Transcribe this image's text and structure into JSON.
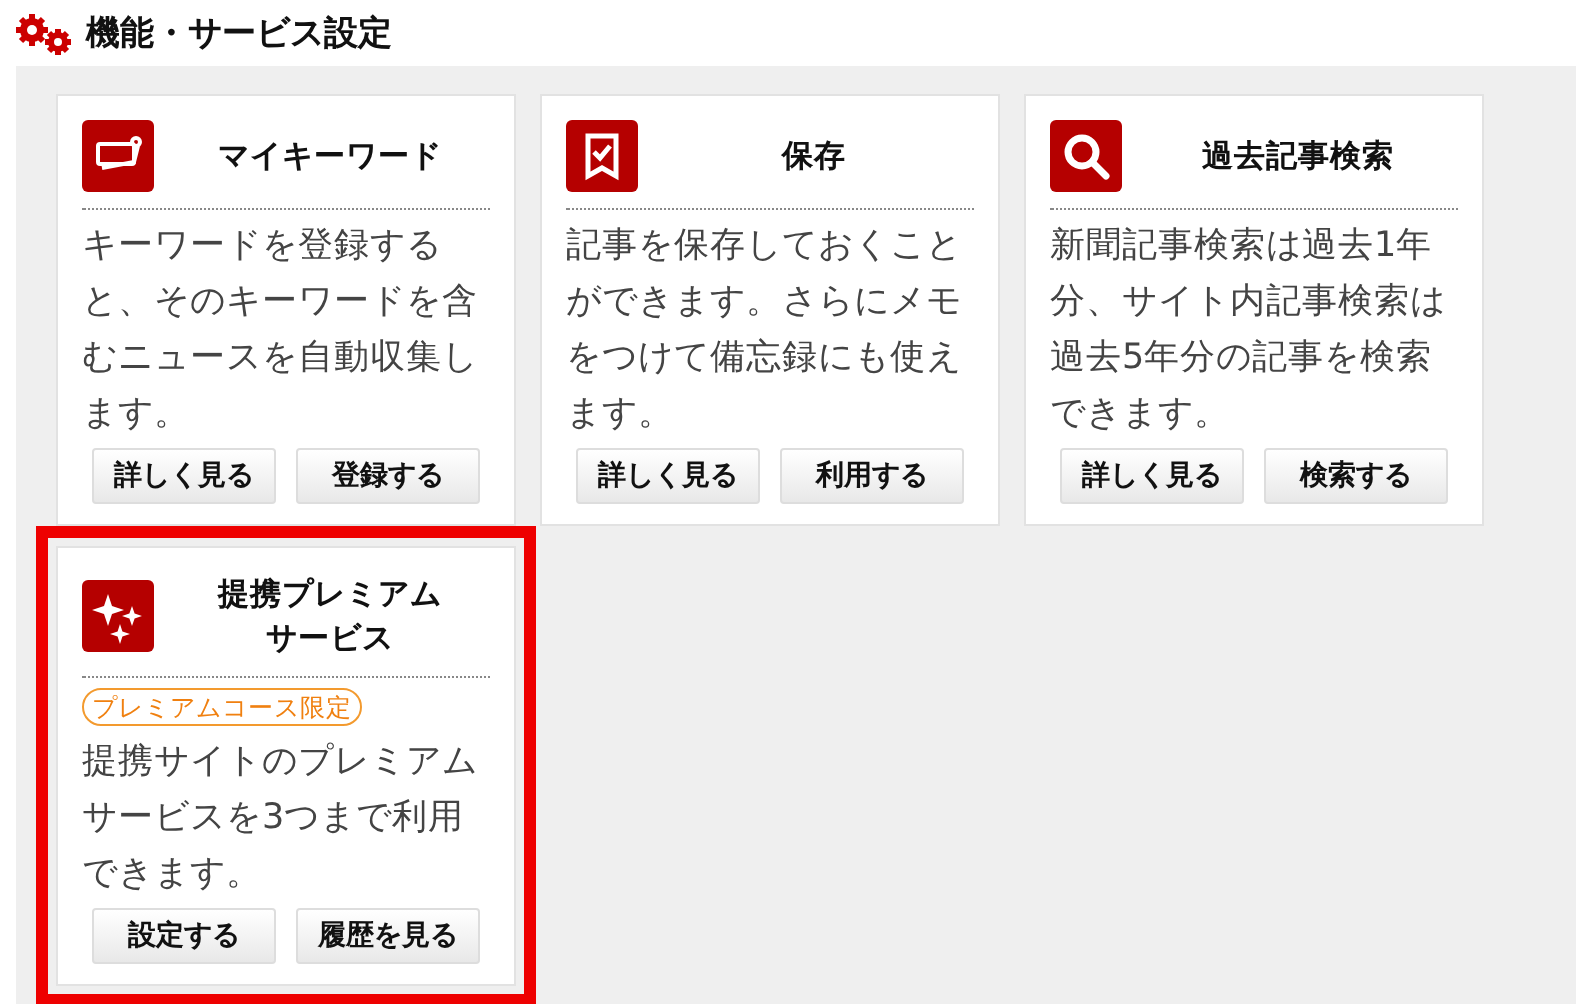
{
  "header": {
    "title": "機能・サービス設定"
  },
  "cards": [
    {
      "kind": "keyword",
      "title_lines": [
        "マイキーワード"
      ],
      "description_lines": [
        "キーワードを登録する",
        "と、そのキーワードを含",
        "むニュースを自動収集し",
        "ます。"
      ],
      "buttons": [
        "詳しく見る",
        "登録する"
      ],
      "highlighted": false
    },
    {
      "kind": "save",
      "title_lines": [
        "保存"
      ],
      "description_lines": [
        "記事を保存しておくこと",
        "ができます。さらにメモ",
        "をつけて備忘録にも使え",
        "ます。"
      ],
      "buttons": [
        "詳しく見る",
        "利用する"
      ],
      "highlighted": false
    },
    {
      "kind": "search",
      "title_lines": [
        "過去記事検索"
      ],
      "description_lines": [
        "新聞記事検索は過去1年",
        "分、サイト内記事検索は",
        "過去5年分の記事を検索",
        "できます。"
      ],
      "buttons": [
        "詳しく見る",
        "検索する"
      ],
      "highlighted": false
    },
    {
      "kind": "sparkle",
      "title_lines": [
        "提携プレミアム",
        "サービス"
      ],
      "badge": "プレミアムコース限定",
      "description_lines": [
        "提携サイトのプレミアム",
        "サービスを3つまで利用",
        "できます。"
      ],
      "buttons": [
        "設定する",
        "履歴を見る"
      ],
      "highlighted": true
    }
  ]
}
